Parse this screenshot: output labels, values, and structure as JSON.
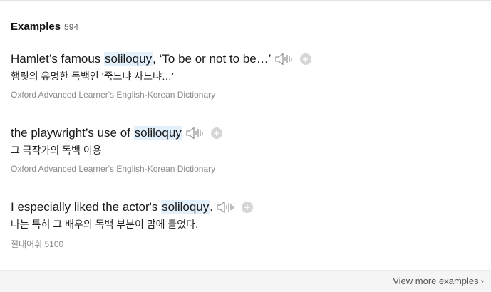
{
  "header": {
    "title": "Examples",
    "count": "594"
  },
  "examples": [
    {
      "before": "Hamlet’s famous ",
      "highlight": "soliloquy",
      "after": ", ‘To be or not to be…’",
      "translation": "햄릿의 유명한 독백인 ‘죽느냐 사느냐…’",
      "source": "Oxford Advanced Learner's English-Korean Dictionary"
    },
    {
      "before": "the playwright’s use of ",
      "highlight": "soliloquy",
      "after": "",
      "translation": "그 극작가의 독백 이용",
      "source": "Oxford Advanced Learner's English-Korean Dictionary"
    },
    {
      "before": "I especially liked the actor's ",
      "highlight": "soliloquy",
      "after": ".",
      "translation": "나는 특히 그 배우의 독백 부분이 맘에 들었다.",
      "source": "절대어휘 5100"
    }
  ],
  "icons": {
    "speaker": "speaker-icon",
    "add": "plus-icon",
    "chevron": "chevron-right-icon"
  },
  "plus_glyph": "+",
  "footer": {
    "view_more": "View more examples",
    "chevron": "›"
  },
  "colors": {
    "highlight": "#e2f0fc",
    "source_text": "#8a8a8a",
    "divider": "#ececec"
  }
}
